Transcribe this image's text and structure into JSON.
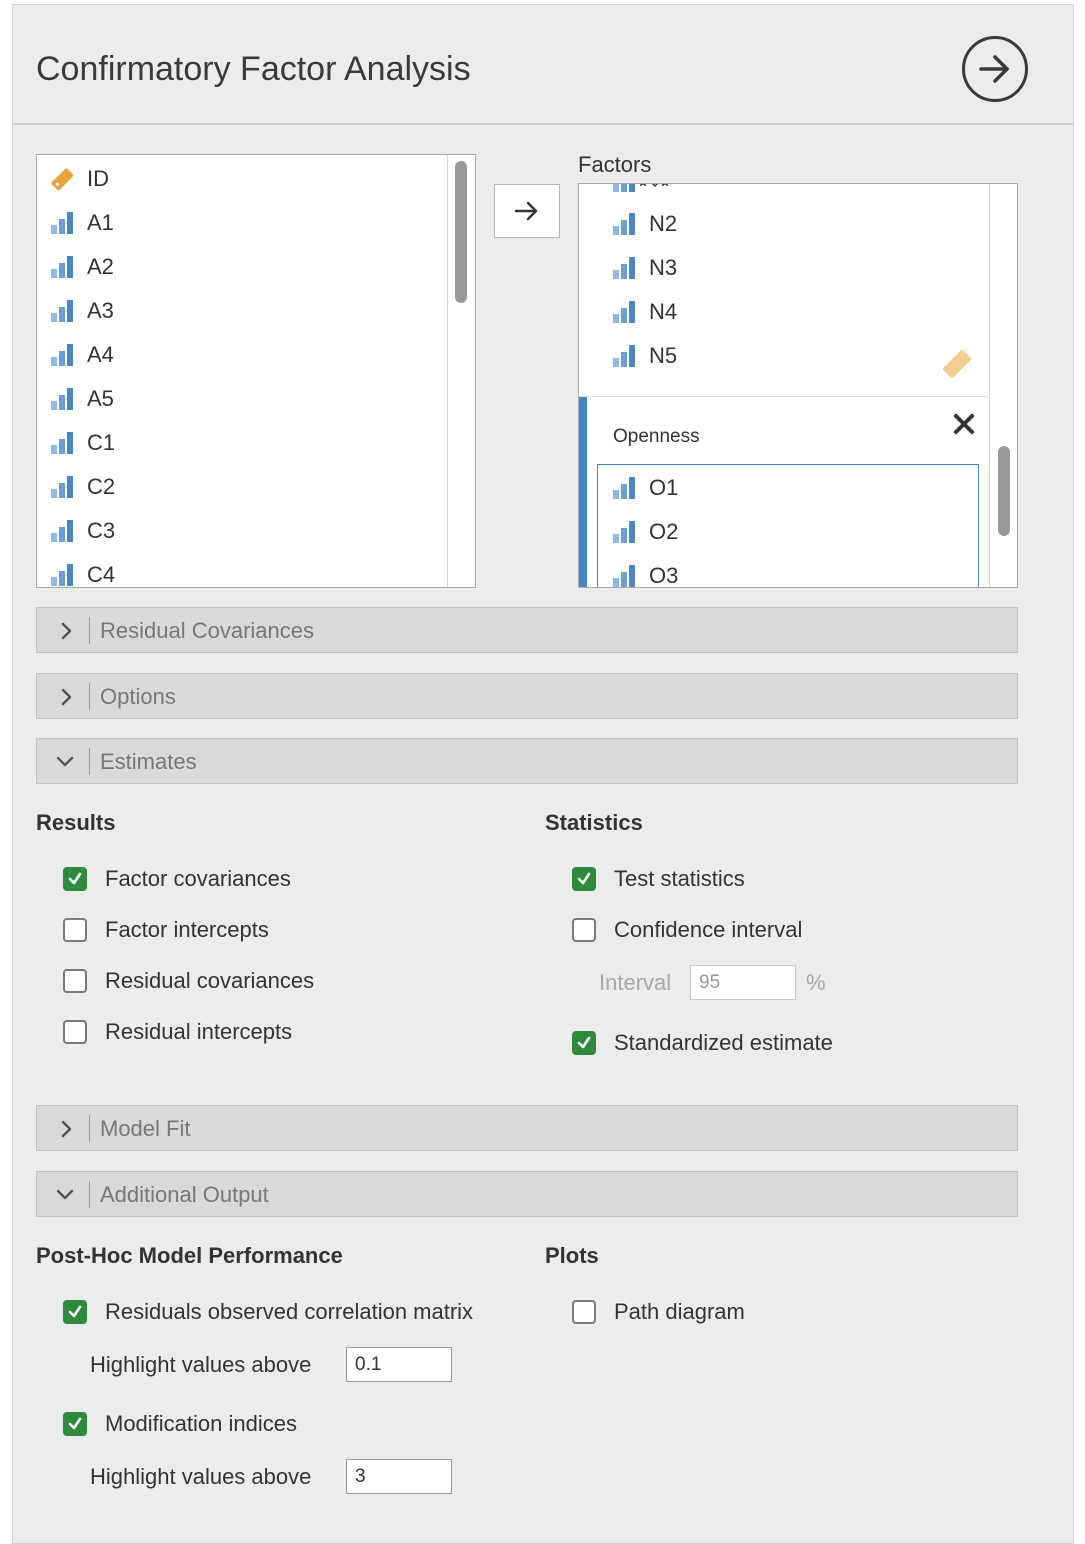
{
  "header": {
    "title": "Confirmatory Factor Analysis",
    "run_icon": "arrow-right-circle-icon"
  },
  "variables": {
    "items": [
      {
        "label": "ID",
        "icon": "nominal-tag-icon"
      },
      {
        "label": "A1",
        "icon": "scale-bars-icon"
      },
      {
        "label": "A2",
        "icon": "scale-bars-icon"
      },
      {
        "label": "A3",
        "icon": "scale-bars-icon"
      },
      {
        "label": "A4",
        "icon": "scale-bars-icon"
      },
      {
        "label": "A5",
        "icon": "scale-bars-icon"
      },
      {
        "label": "C1",
        "icon": "scale-bars-icon"
      },
      {
        "label": "C2",
        "icon": "scale-bars-icon"
      },
      {
        "label": "C3",
        "icon": "scale-bars-icon"
      },
      {
        "label": "C4",
        "icon": "scale-bars-icon"
      }
    ]
  },
  "factors": {
    "label": "Factors",
    "group1": {
      "items": [
        {
          "label": "N2"
        },
        {
          "label": "N3"
        },
        {
          "label": "N4"
        },
        {
          "label": "N5"
        }
      ]
    },
    "group2": {
      "name": "Openness",
      "items": [
        {
          "label": "O1"
        },
        {
          "label": "O2"
        },
        {
          "label": "O3"
        }
      ]
    }
  },
  "sections": {
    "residual_covariances": "Residual Covariances",
    "options": "Options",
    "estimates": "Estimates",
    "model_fit": "Model Fit",
    "additional_output": "Additional Output"
  },
  "estimates": {
    "results_title": "Results",
    "statistics_title": "Statistics",
    "results": [
      {
        "label": "Factor covariances",
        "checked": true
      },
      {
        "label": "Factor intercepts",
        "checked": false
      },
      {
        "label": "Residual covariances",
        "checked": false
      },
      {
        "label": "Residual intercepts",
        "checked": false
      }
    ],
    "test_statistics": {
      "label": "Test statistics",
      "checked": true
    },
    "confidence_interval": {
      "label": "Confidence interval",
      "checked": false
    },
    "interval": {
      "label": "Interval",
      "value": "95",
      "unit": "%"
    },
    "standardized": {
      "label": "Standardized estimate",
      "checked": true
    }
  },
  "additional": {
    "posthoc_title": "Post-Hoc Model Performance",
    "plots_title": "Plots",
    "residuals_matrix": {
      "label": "Residuals observed correlation matrix",
      "checked": true
    },
    "residuals_highlight": {
      "label": "Highlight values above",
      "value": "0.1"
    },
    "mod_indices": {
      "label": "Modification indices",
      "checked": true
    },
    "mod_highlight": {
      "label": "Highlight values above",
      "value": "3"
    },
    "path_diagram": {
      "label": "Path diagram",
      "checked": false
    }
  },
  "colors": {
    "accent": "#2e8b3e",
    "scale_icon": "#6a9fd8",
    "nominal_icon": "#e8a33a",
    "group_bar": "#3f87c5"
  }
}
